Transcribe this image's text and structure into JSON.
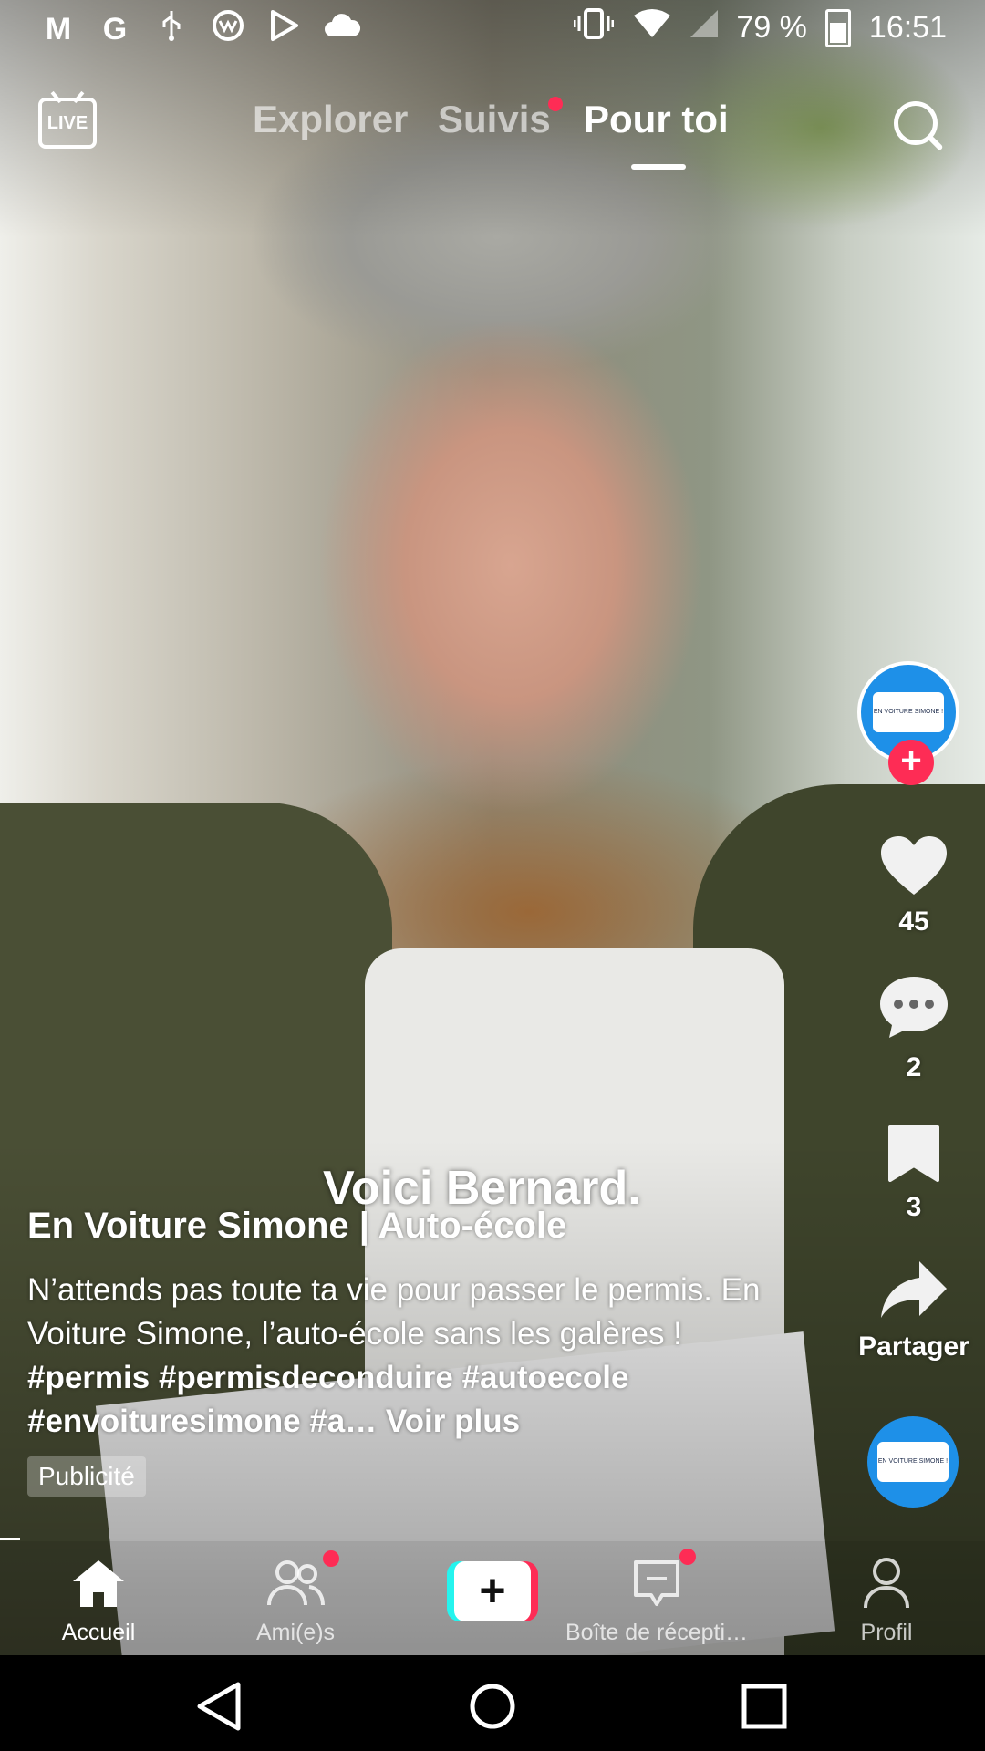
{
  "status_bar": {
    "battery": "79 %",
    "time": "16:51",
    "left_icons": [
      "gmail-icon",
      "google-icon",
      "usb-icon",
      "world-icon",
      "play-store-icon",
      "cloud-icon"
    ],
    "right_icons": [
      "vibrate-icon",
      "wifi-icon",
      "no-sim-icon",
      "battery-icon"
    ]
  },
  "top_nav": {
    "live_label": "LIVE",
    "tabs": [
      {
        "label": "Explorer",
        "active": false
      },
      {
        "label": "Suivis",
        "active": false,
        "notification_dot": true
      },
      {
        "label": "Pour toi",
        "active": true
      }
    ]
  },
  "video": {
    "overlay_caption": "Voici Bernard."
  },
  "sidebar": {
    "avatar_text": "EN VOITURE SIMONE !",
    "likes": "45",
    "comments": "2",
    "saves": "3",
    "share_label": "Partager"
  },
  "post": {
    "account_name": "En Voiture Simone | Auto-école",
    "description": "N’attends pas toute ta vie pour passer le permis. En Voiture Simone, l’auto-école sans les galères ! ",
    "hashtags": "#permis #permisdeconduire #autoecole #envoituresimone #a…",
    "see_more": " Voir plus",
    "ad_label": "Publicité"
  },
  "bottom_nav": {
    "items": [
      {
        "label": "Accueil",
        "active": true
      },
      {
        "label": "Ami(e)s",
        "active": false,
        "notification_dot": true
      },
      {
        "label": "",
        "create": true
      },
      {
        "label": "Boîte de récepti…",
        "active": false,
        "notification_dot": true
      },
      {
        "label": "Profil",
        "active": false
      }
    ]
  },
  "colors": {
    "accent": "#fe2c55",
    "cyan": "#25f4ee",
    "brand_blue": "#1e90e8"
  }
}
